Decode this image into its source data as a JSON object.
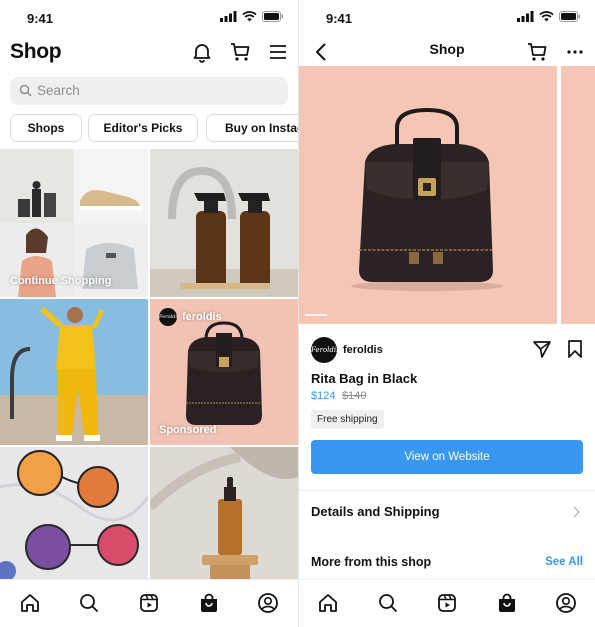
{
  "left": {
    "status": {
      "time": "9:41"
    },
    "title": "Shop",
    "search": {
      "placeholder": "Search"
    },
    "pills": [
      "Shops",
      "Editor's Picks",
      "Buy on Instag"
    ],
    "tiles": {
      "continue_label": "Continue Shopping",
      "seller_handle": "feroldis",
      "sponsored_label": "Sponsored"
    }
  },
  "right": {
    "status": {
      "time": "9:41"
    },
    "title": "Shop",
    "seller": {
      "avatar_text": "Feroldis",
      "name": "feroldis"
    },
    "product": {
      "name": "Rita Bag in Black",
      "price": "$124",
      "original_price": "$140",
      "badge": "Free shipping"
    },
    "cta_label": "View on Website",
    "details_label": "Details and Shipping",
    "more_label": "More from this shop",
    "see_all_label": "See All"
  },
  "colors": {
    "accent": "#3897f0",
    "hero_bg": "#f5c5b5"
  }
}
